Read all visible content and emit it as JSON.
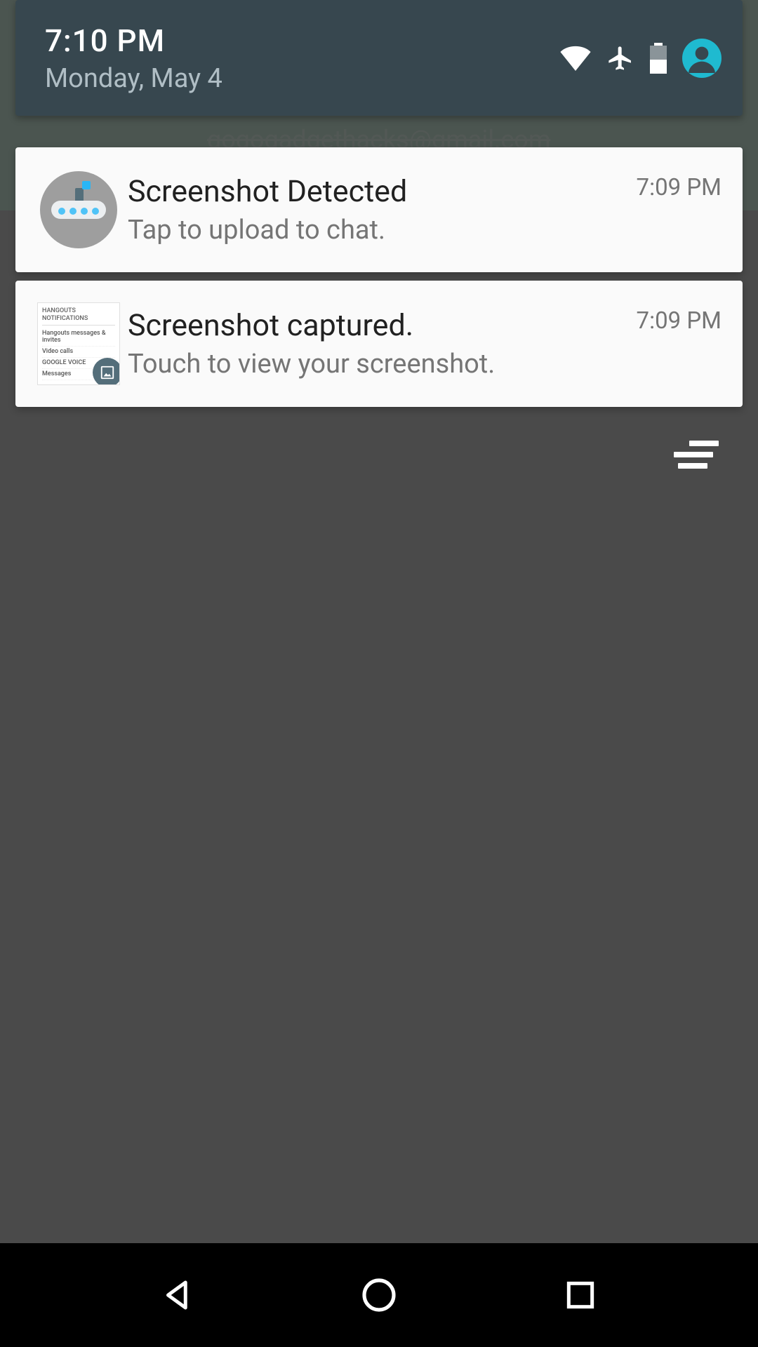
{
  "header": {
    "time": "7:10 PM",
    "date": "Monday, May 4"
  },
  "status_icons": {
    "wifi": "wifi-icon",
    "airplane": "airplane-icon",
    "battery": "battery-icon",
    "profile": "profile-icon"
  },
  "background": {
    "email_hint": "gogogadgethacks@gmail.com"
  },
  "notifications": [
    {
      "title": "Screenshot Detected",
      "subtitle": "Tap to upload to chat.",
      "time": "7:09 PM",
      "icon": "submarine-app-icon"
    },
    {
      "title": "Screenshot captured.",
      "subtitle": "Touch to view your screenshot.",
      "time": "7:09 PM",
      "icon": "screenshot-thumbnail"
    }
  ],
  "thumbnail": {
    "heading": "HANGOUTS NOTIFICATIONS",
    "row1": "Hangouts messages & invites",
    "row2": "Video calls",
    "row3": "GOOGLE VOICE",
    "row4": "Messages"
  },
  "nav": {
    "back": "back-button",
    "home": "home-button",
    "recent": "recent-apps-button"
  }
}
